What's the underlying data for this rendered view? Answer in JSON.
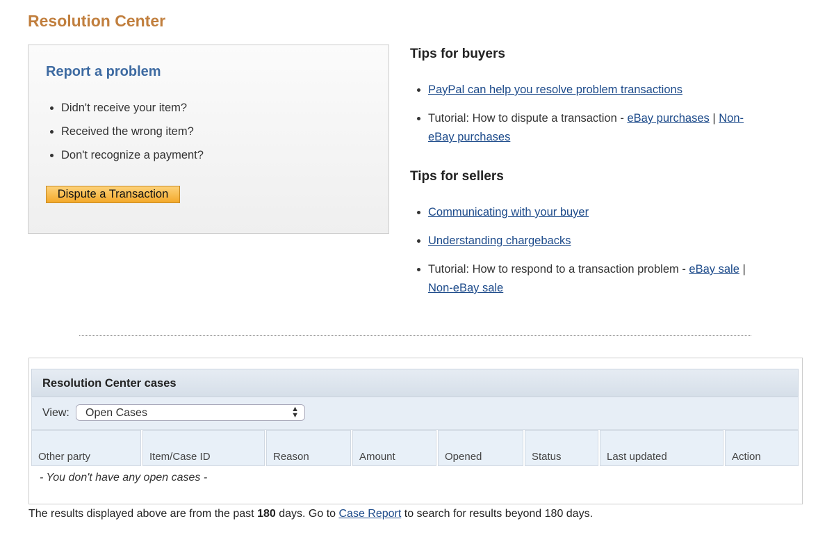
{
  "page_title": "Resolution Center",
  "report": {
    "title": "Report a problem",
    "items": [
      "Didn't receive your item?",
      "Received the wrong item?",
      "Don't recognize a payment?"
    ],
    "button": "Dispute a Transaction"
  },
  "buyers": {
    "title": "Tips for buyers",
    "link1": "PayPal can help you resolve problem transactions",
    "tutorial_text": "Tutorial: How to dispute a transaction - ",
    "link_ebay": "eBay purchases",
    "sep": " | ",
    "link_non_ebay": "Non-eBay purchases"
  },
  "sellers": {
    "title": "Tips for sellers",
    "link1": "Communicating with your buyer",
    "link2": "Understanding chargebacks",
    "tutorial_text": "Tutorial: How to respond to a transaction problem - ",
    "link_ebay": "eBay sale",
    "sep": " | ",
    "link_non_ebay": "Non-eBay sale"
  },
  "cases": {
    "title": "Resolution Center cases",
    "view_label": "View:",
    "view_value": "Open Cases",
    "columns": [
      "Other party",
      "Item/Case ID",
      "Reason",
      "Amount",
      "Opened",
      "Status",
      "Last updated",
      "Action"
    ],
    "empty": "- You don't have any open cases -"
  },
  "footer": {
    "pre": "The results displayed above are from the past ",
    "days": "180",
    "mid": " days. Go to ",
    "link": "Case Report",
    "post": " to search for results beyond 180 days."
  },
  "colors": {
    "title": "#c17f3e",
    "heading_blue": "#3d6aa1",
    "link": "#1c4a8a",
    "button": "#f4a92a"
  }
}
